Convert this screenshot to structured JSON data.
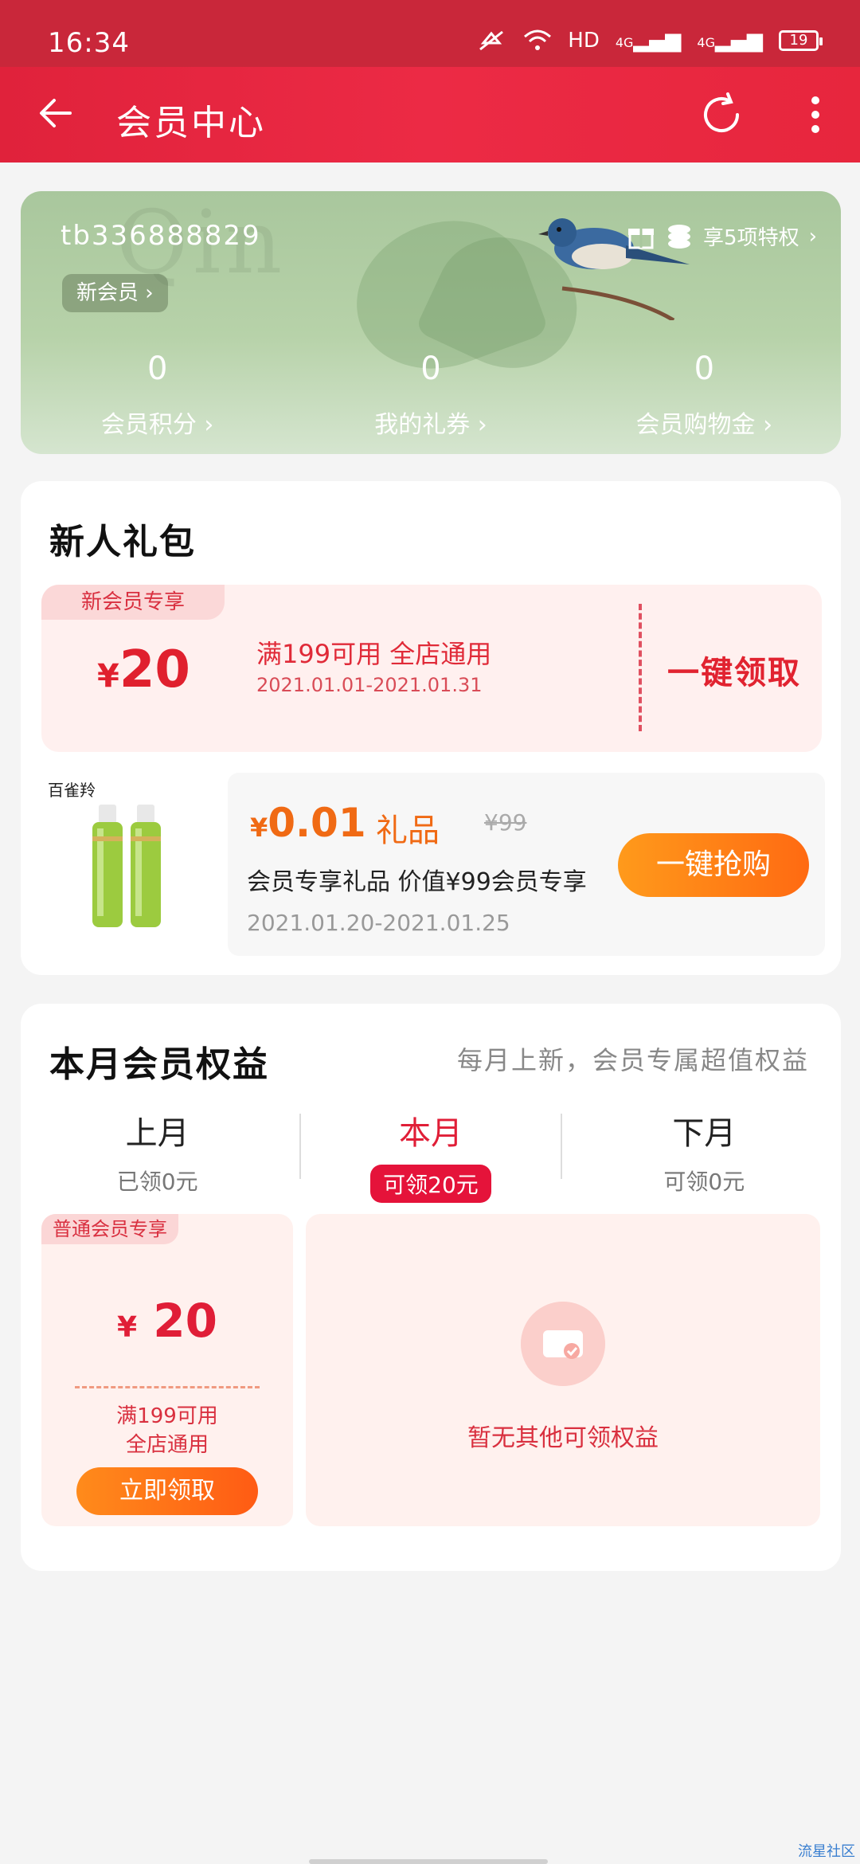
{
  "status_bar": {
    "time": "16:34",
    "network": "HD",
    "signal1": "4G",
    "signal2": "4G",
    "battery": "19"
  },
  "app_bar": {
    "title": "会员中心"
  },
  "member_card": {
    "user_id": "tb336888829",
    "level_label": "新会员",
    "privilege_label": "享5项特权",
    "stats": [
      {
        "value": "0",
        "label": "会员积分"
      },
      {
        "value": "0",
        "label": "我的礼券"
      },
      {
        "value": "0",
        "label": "会员购物金"
      }
    ]
  },
  "new_gift": {
    "title": "新人礼包",
    "coupon": {
      "tag": "新会员专享",
      "currency": "¥",
      "amount": "20",
      "condition": "满199可用 全店通用",
      "date_range": "2021.01.01-2021.01.31",
      "claim_label": "一键领取"
    },
    "product": {
      "brand": "百雀羚",
      "currency": "¥",
      "price": "0.01",
      "gift_label": "礼品",
      "original_price": "¥99",
      "description": "会员专享礼品 价值¥99会员专享",
      "date_range": "2021.01.20-2021.01.25",
      "buy_label": "一键抢购"
    }
  },
  "monthly": {
    "title": "本月会员权益",
    "subtitle": "每月上新，会员专属超值权益",
    "months": [
      {
        "name": "上月",
        "status": "已领0元"
      },
      {
        "name": "本月",
        "status": "可领20元"
      },
      {
        "name": "下月",
        "status": "可领0元"
      }
    ],
    "active_month_index": 1,
    "benefit": {
      "tag": "普通会员专享",
      "currency": "¥",
      "amount": "20",
      "condition_line1": "满199可用",
      "condition_line2": "全店通用",
      "button_label": "立即领取"
    },
    "empty_text": "暂无其他可领权益"
  },
  "watermark": "流星社区",
  "colors": {
    "primary_red": "#e0223b",
    "accent_orange": "#ff6a12",
    "card_green": "#a9c79d"
  }
}
